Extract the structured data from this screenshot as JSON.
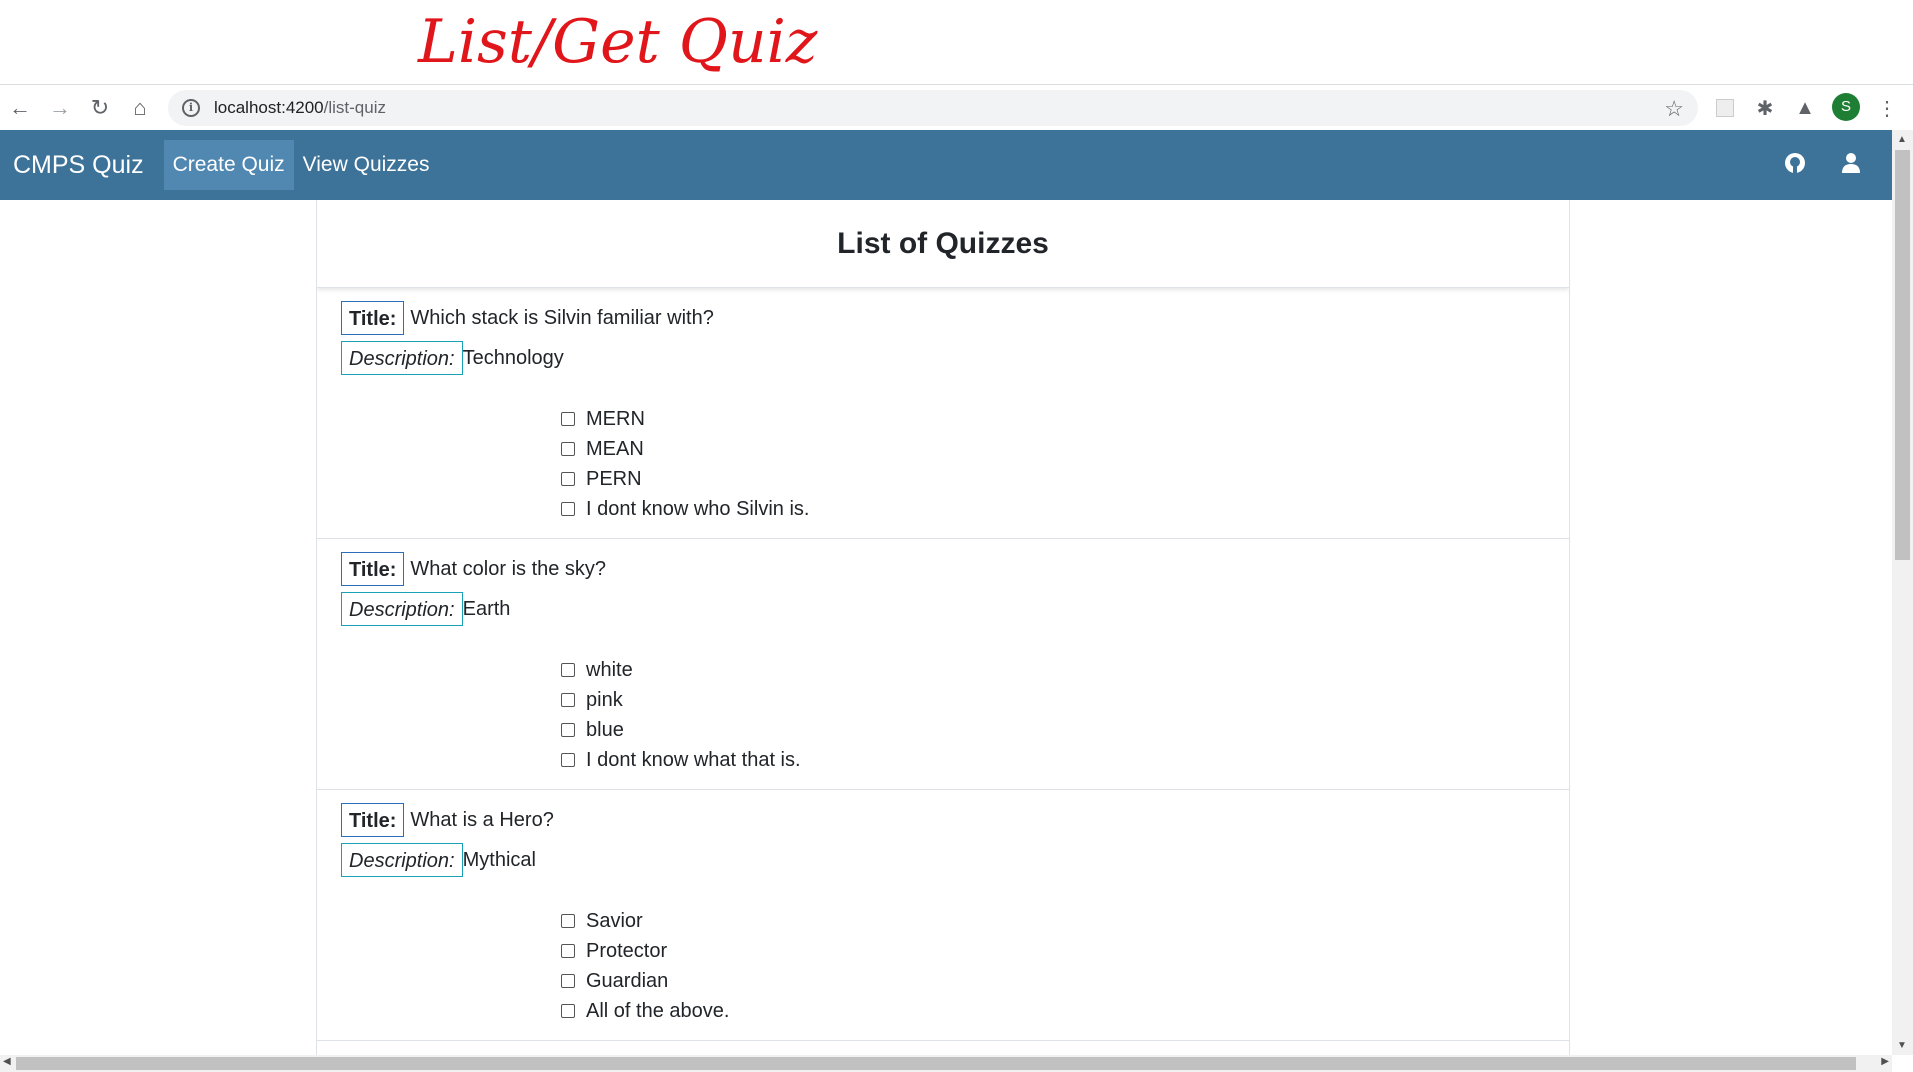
{
  "annotation": {
    "text": "List/Get Quiz",
    "color": "#e0161b"
  },
  "browser": {
    "url_host": "localhost:4200",
    "url_path": "/list-quiz",
    "profile_initial": "S"
  },
  "navbar": {
    "brand": "CMPS Quiz",
    "links": [
      "Create Quiz",
      "View Quizzes"
    ],
    "color": "#3d7299"
  },
  "page": {
    "heading": "List of Quizzes"
  },
  "labels": {
    "title": "Title:",
    "description": "Description:"
  },
  "quizzes": [
    {
      "title": "Which stack is Silvin familiar with?",
      "description": "Technology",
      "options": [
        "MERN",
        "MEAN",
        "PERN",
        "I dont know who Silvin is."
      ]
    },
    {
      "title": "What color is the sky?",
      "description": "Earth",
      "options": [
        "white",
        "pink",
        "blue",
        "I dont know what that is."
      ]
    },
    {
      "title": "What is a Hero?",
      "description": "Mythical",
      "options": [
        "Savior",
        "Protector",
        "Guardian",
        "All of the above."
      ]
    }
  ]
}
